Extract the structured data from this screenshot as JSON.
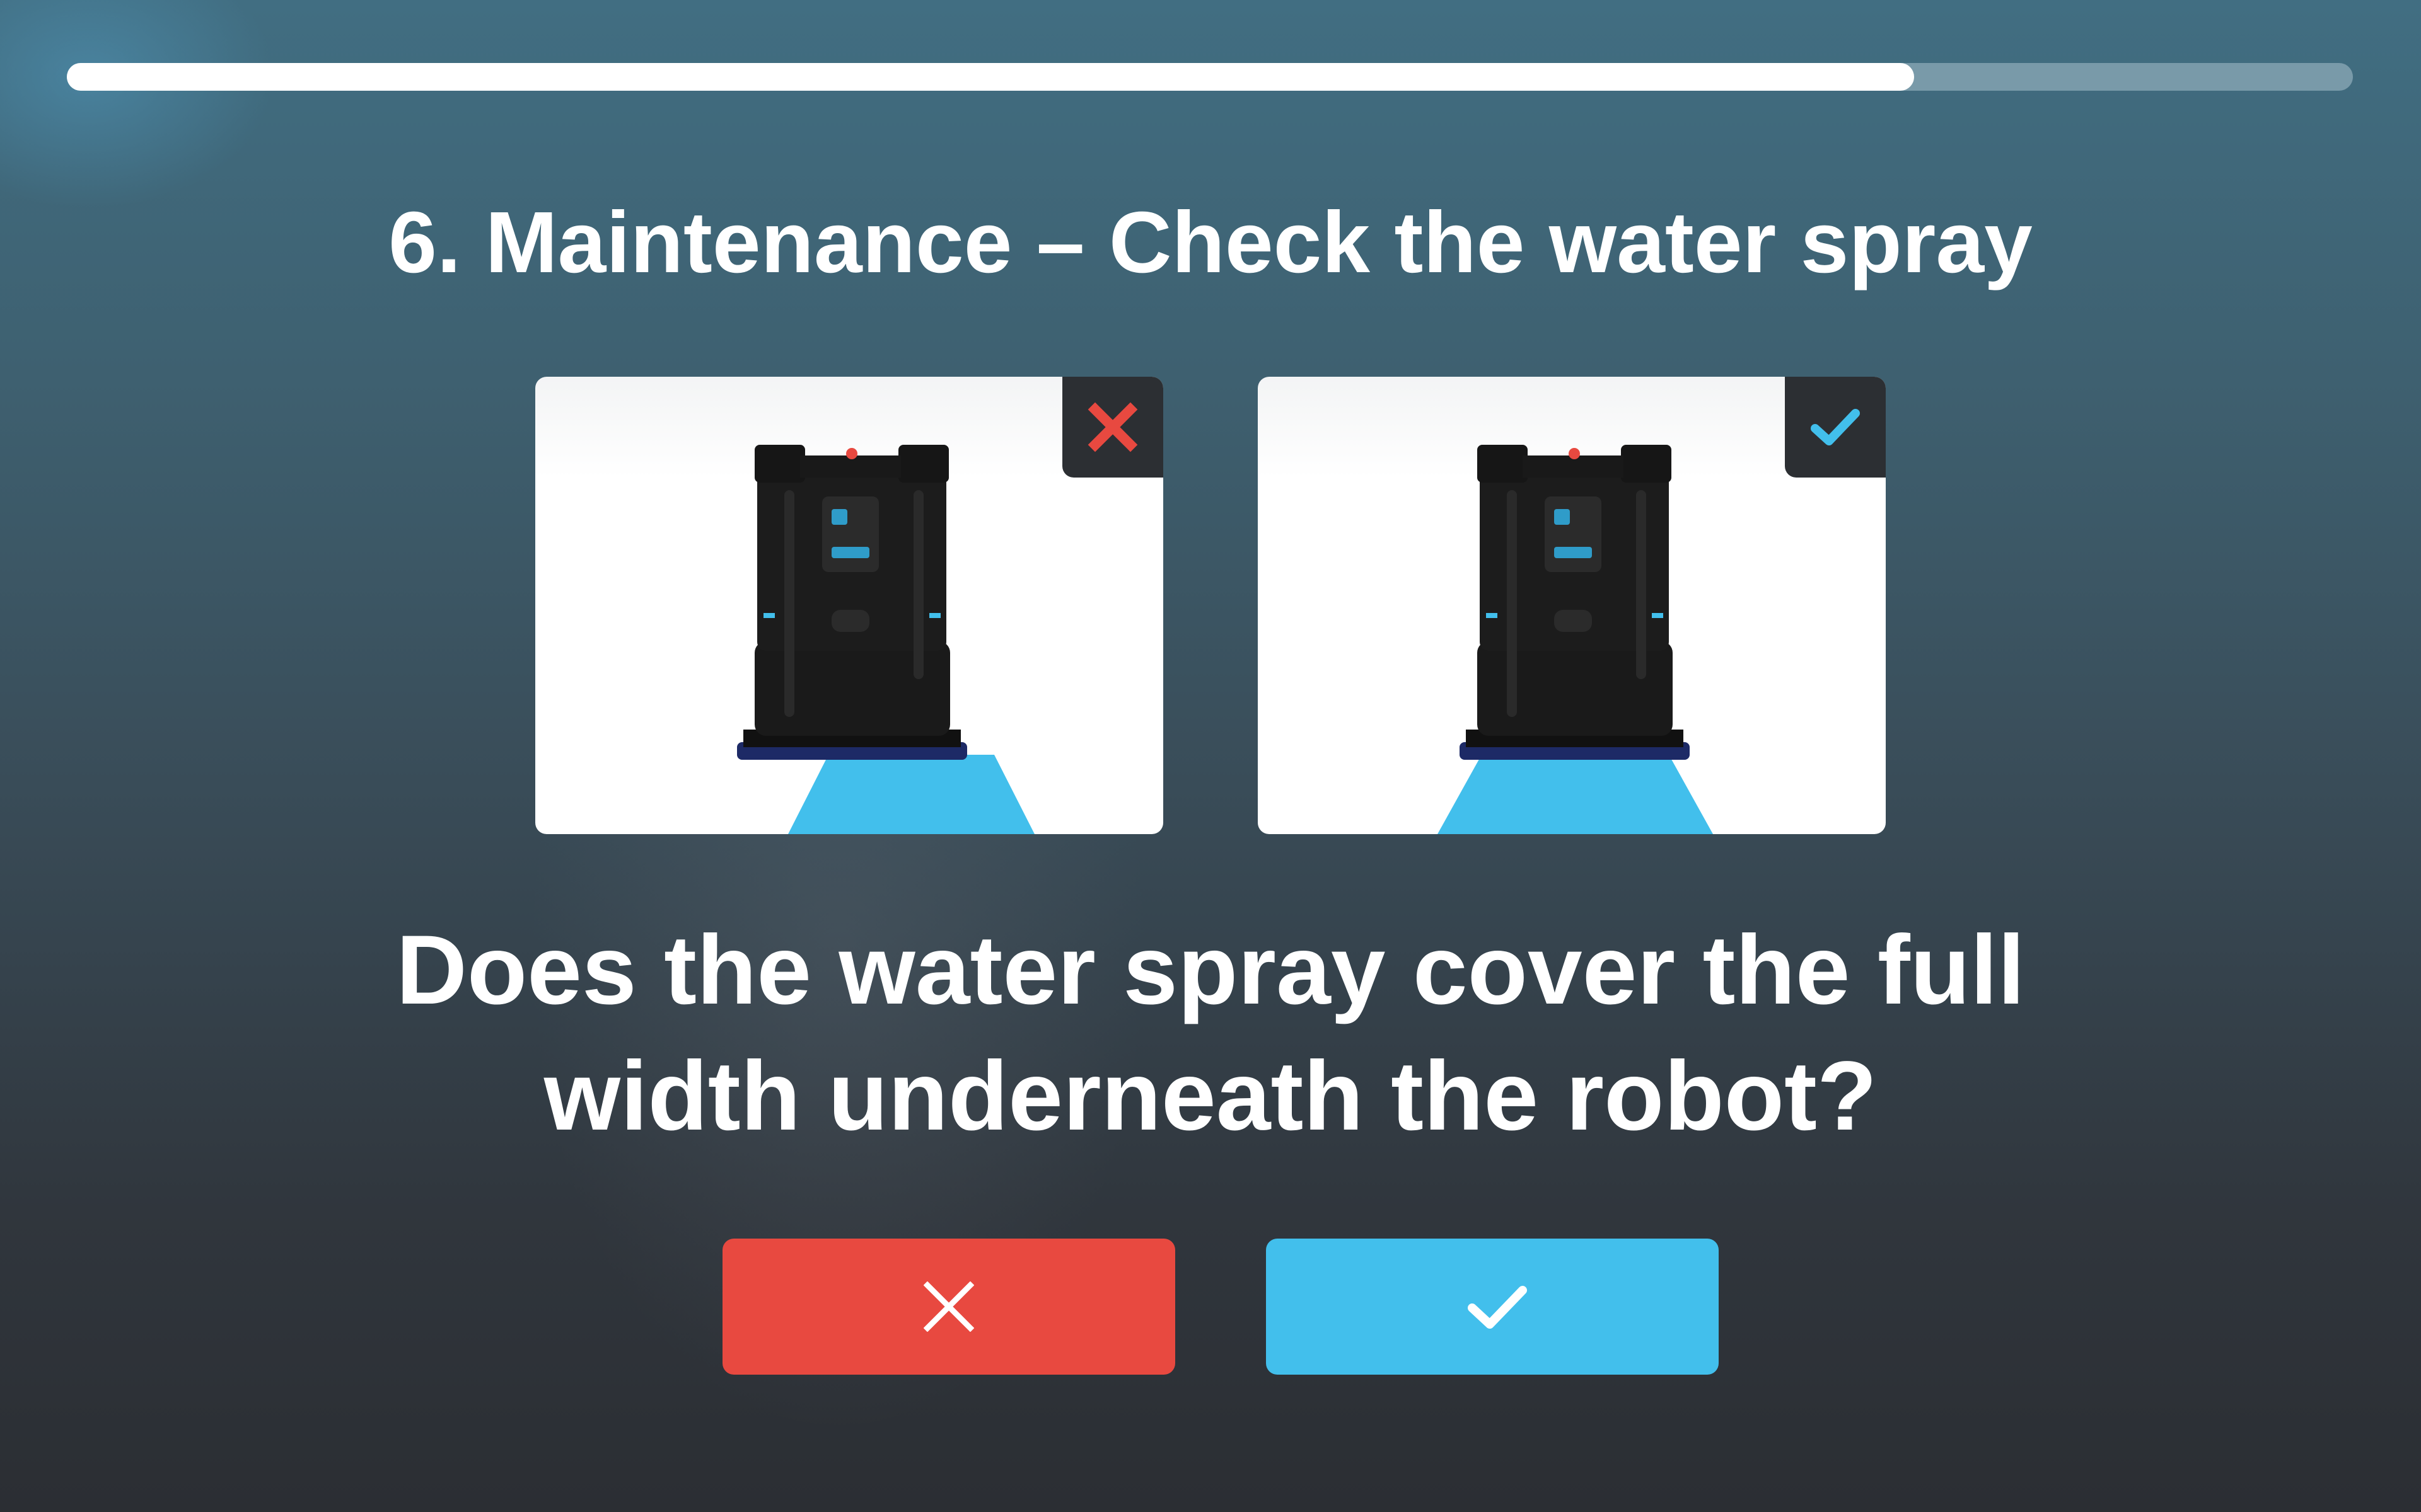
{
  "progress": {
    "fraction": 0.808
  },
  "title": "6. Maintenance – Check the water spray",
  "examples": [
    {
      "label": "incorrect",
      "icon": "x-icon",
      "badge_color": "#e84940",
      "spray": "narrow"
    },
    {
      "label": "correct",
      "icon": "check-icon",
      "badge_color": "#42bfec",
      "spray": "full"
    }
  ],
  "question": {
    "line1": "Does the water spray cover the full",
    "line2": "width underneath the robot?"
  },
  "buttons": {
    "no": {
      "icon": "x-icon",
      "color": "#e84940"
    },
    "yes": {
      "icon": "check-icon",
      "color": "#42bfec"
    }
  },
  "colors": {
    "accent_blue": "#42bfec",
    "accent_red": "#e84940",
    "spray": "#42bfec"
  }
}
